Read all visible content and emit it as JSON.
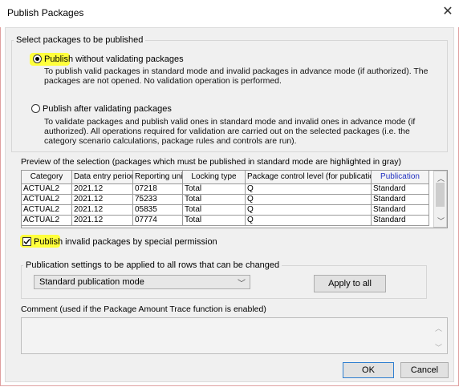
{
  "window": {
    "title": "Publish Packages",
    "close_symbol": "✕"
  },
  "select_group": {
    "label": "Select packages to be published",
    "option1": {
      "label_highlight": "Publish",
      "label_rest": " without validating packages",
      "selected": true,
      "description": "To publish valid packages in standard mode and invalid packages in advance mode (if authorized). The packages are not opened. No validation operation is performed."
    },
    "option2": {
      "label": "Publish after validating packages",
      "selected": false,
      "description": "To validate packages and publish valid ones in standard mode and invalid ones in advance mode (if authorized). All operations required for validation are carried out on the selected packages (i.e. the category scenario calculations, package rules and controls are run)."
    }
  },
  "preview": {
    "label": "Preview of the selection (packages which must be published in standard mode are highlighted in gray)",
    "columns": [
      "Category",
      "Data entry period",
      "Reporting unit",
      "Locking type",
      "Package control level (for publication)",
      "Publication"
    ],
    "rows": [
      [
        "ACTUAL2",
        "2021.12",
        "07218",
        "Total",
        "Q",
        "Standard"
      ],
      [
        "ACTUAL2",
        "2021.12",
        "75233",
        "Total",
        "Q",
        "Standard"
      ],
      [
        "ACTUAL2",
        "2021.12",
        "05835",
        "Total",
        "Q",
        "Standard"
      ],
      [
        "ACTUAL2",
        "2021.12",
        "07774",
        "Total",
        "Q",
        "Standard"
      ]
    ]
  },
  "special_permission": {
    "label_highlight": "Publish",
    "label_rest": " invalid packages by special permission",
    "checked": true
  },
  "publication_settings": {
    "label": "Publication settings to be applied to all rows that can be changed",
    "selected_mode": "Standard publication mode",
    "apply_button": "Apply to all"
  },
  "comment": {
    "label": "Comment (used if the Package Amount Trace function is enabled)",
    "value": ""
  },
  "buttons": {
    "ok": "OK",
    "cancel": "Cancel"
  },
  "colors": {
    "highlight": "#ffff3c",
    "publication_header": "#2030c0",
    "primary_border": "#2f7fd0"
  }
}
